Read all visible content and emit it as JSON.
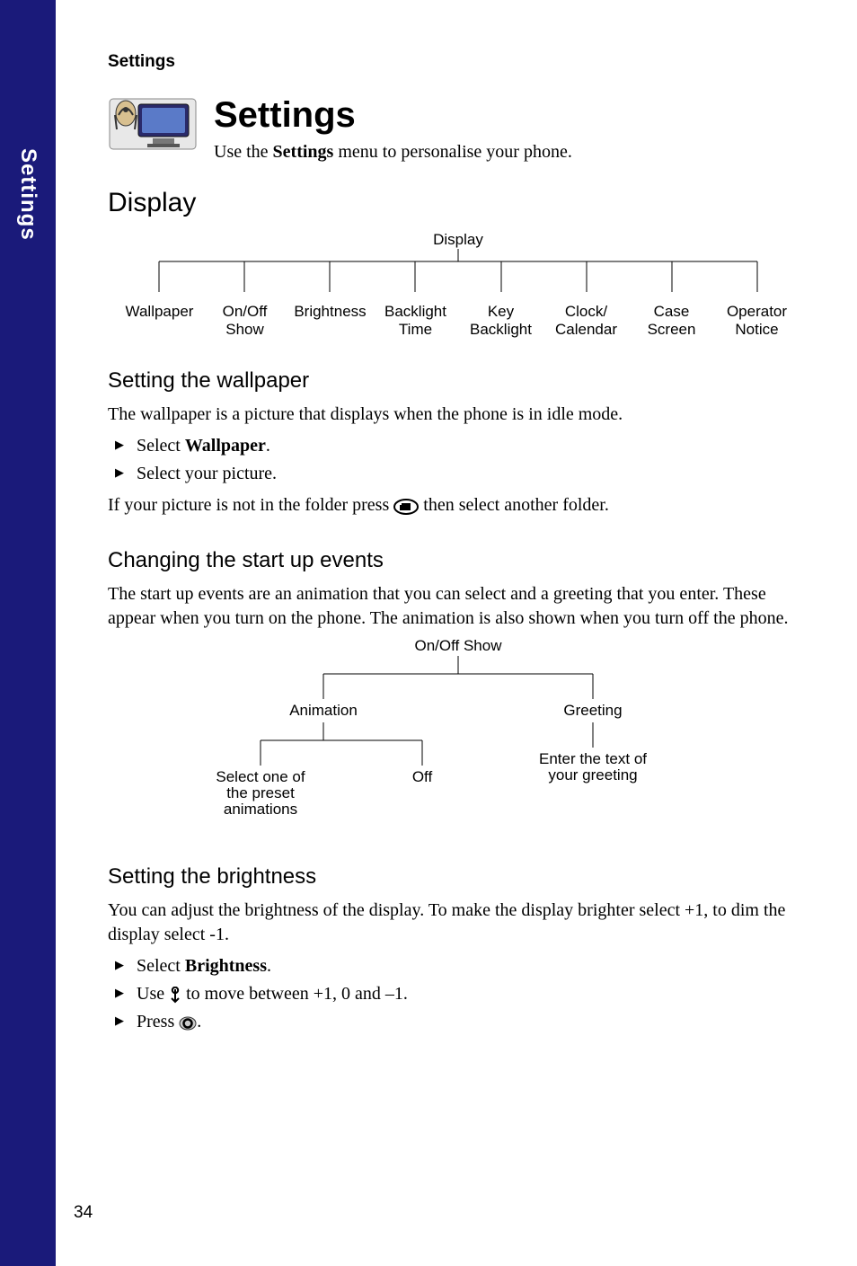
{
  "sideTab": "Settings",
  "headerLabel": "Settings",
  "pageTitle": "Settings",
  "introPrefix": "Use the ",
  "introBold": "Settings",
  "introSuffix": " menu to personalise your phone.",
  "displayHeading": "Display",
  "displayTree": {
    "root": "Display",
    "children": [
      "Wallpaper",
      "On/Off\nShow",
      "Brightness",
      "Backlight\nTime",
      "Key\nBacklight",
      "Clock/\nCalendar",
      "Case\nScreen",
      "Operator\nNotice"
    ]
  },
  "wallpaper": {
    "heading": "Setting the wallpaper",
    "intro": "The wallpaper is a picture that displays when the phone is in idle mode.",
    "step1Prefix": "Select ",
    "step1Bold": "Wallpaper",
    "step1Suffix": ".",
    "step2": "Select your picture.",
    "afterPrefix": "If your picture is not in the folder press ",
    "afterSuffix": " then select another folder."
  },
  "startup": {
    "heading": "Changing the start up events",
    "intro": "The start up events are an animation that you can select and a greeting that you enter. These appear when you turn on the phone. The animation is also shown when you turn off the phone.",
    "tree": {
      "root": "On/Off Show",
      "animation": "Animation",
      "greeting": "Greeting",
      "selectPreset": "Select one of\nthe preset\nanimations",
      "off": "Off",
      "enterText": "Enter the text of\nyour greeting"
    }
  },
  "brightness": {
    "heading": "Setting the brightness",
    "intro": "You can adjust the brightness of the display. To make the display brighter select +1, to dim the display select -1.",
    "step1Prefix": "Select ",
    "step1Bold": "Brightness",
    "step1Suffix": ".",
    "step2Prefix": "Use ",
    "step2Suffix": " to move between +1, 0 and –1.",
    "step3Prefix": "Press ",
    "step3Suffix": "."
  },
  "pageNumber": "34"
}
